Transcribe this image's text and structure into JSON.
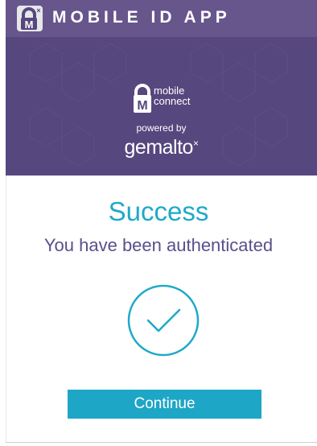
{
  "header": {
    "app_title": "MOBILE ID APP",
    "app_icon": "mobile-connect-lock-icon"
  },
  "banner": {
    "logo_line1": "mobile",
    "logo_line2": "connect",
    "powered_by": "powered by",
    "brand": "gemalto",
    "brand_mark": "×"
  },
  "main": {
    "title": "Success",
    "subtitle": "You have been authenticated",
    "status_icon": "checkmark-circle-icon",
    "continue_label": "Continue"
  },
  "colors": {
    "header_bg": "#67568c",
    "banner_bg": "#56477e",
    "accent": "#1ea9c9",
    "subtitle": "#5a4e8c"
  }
}
